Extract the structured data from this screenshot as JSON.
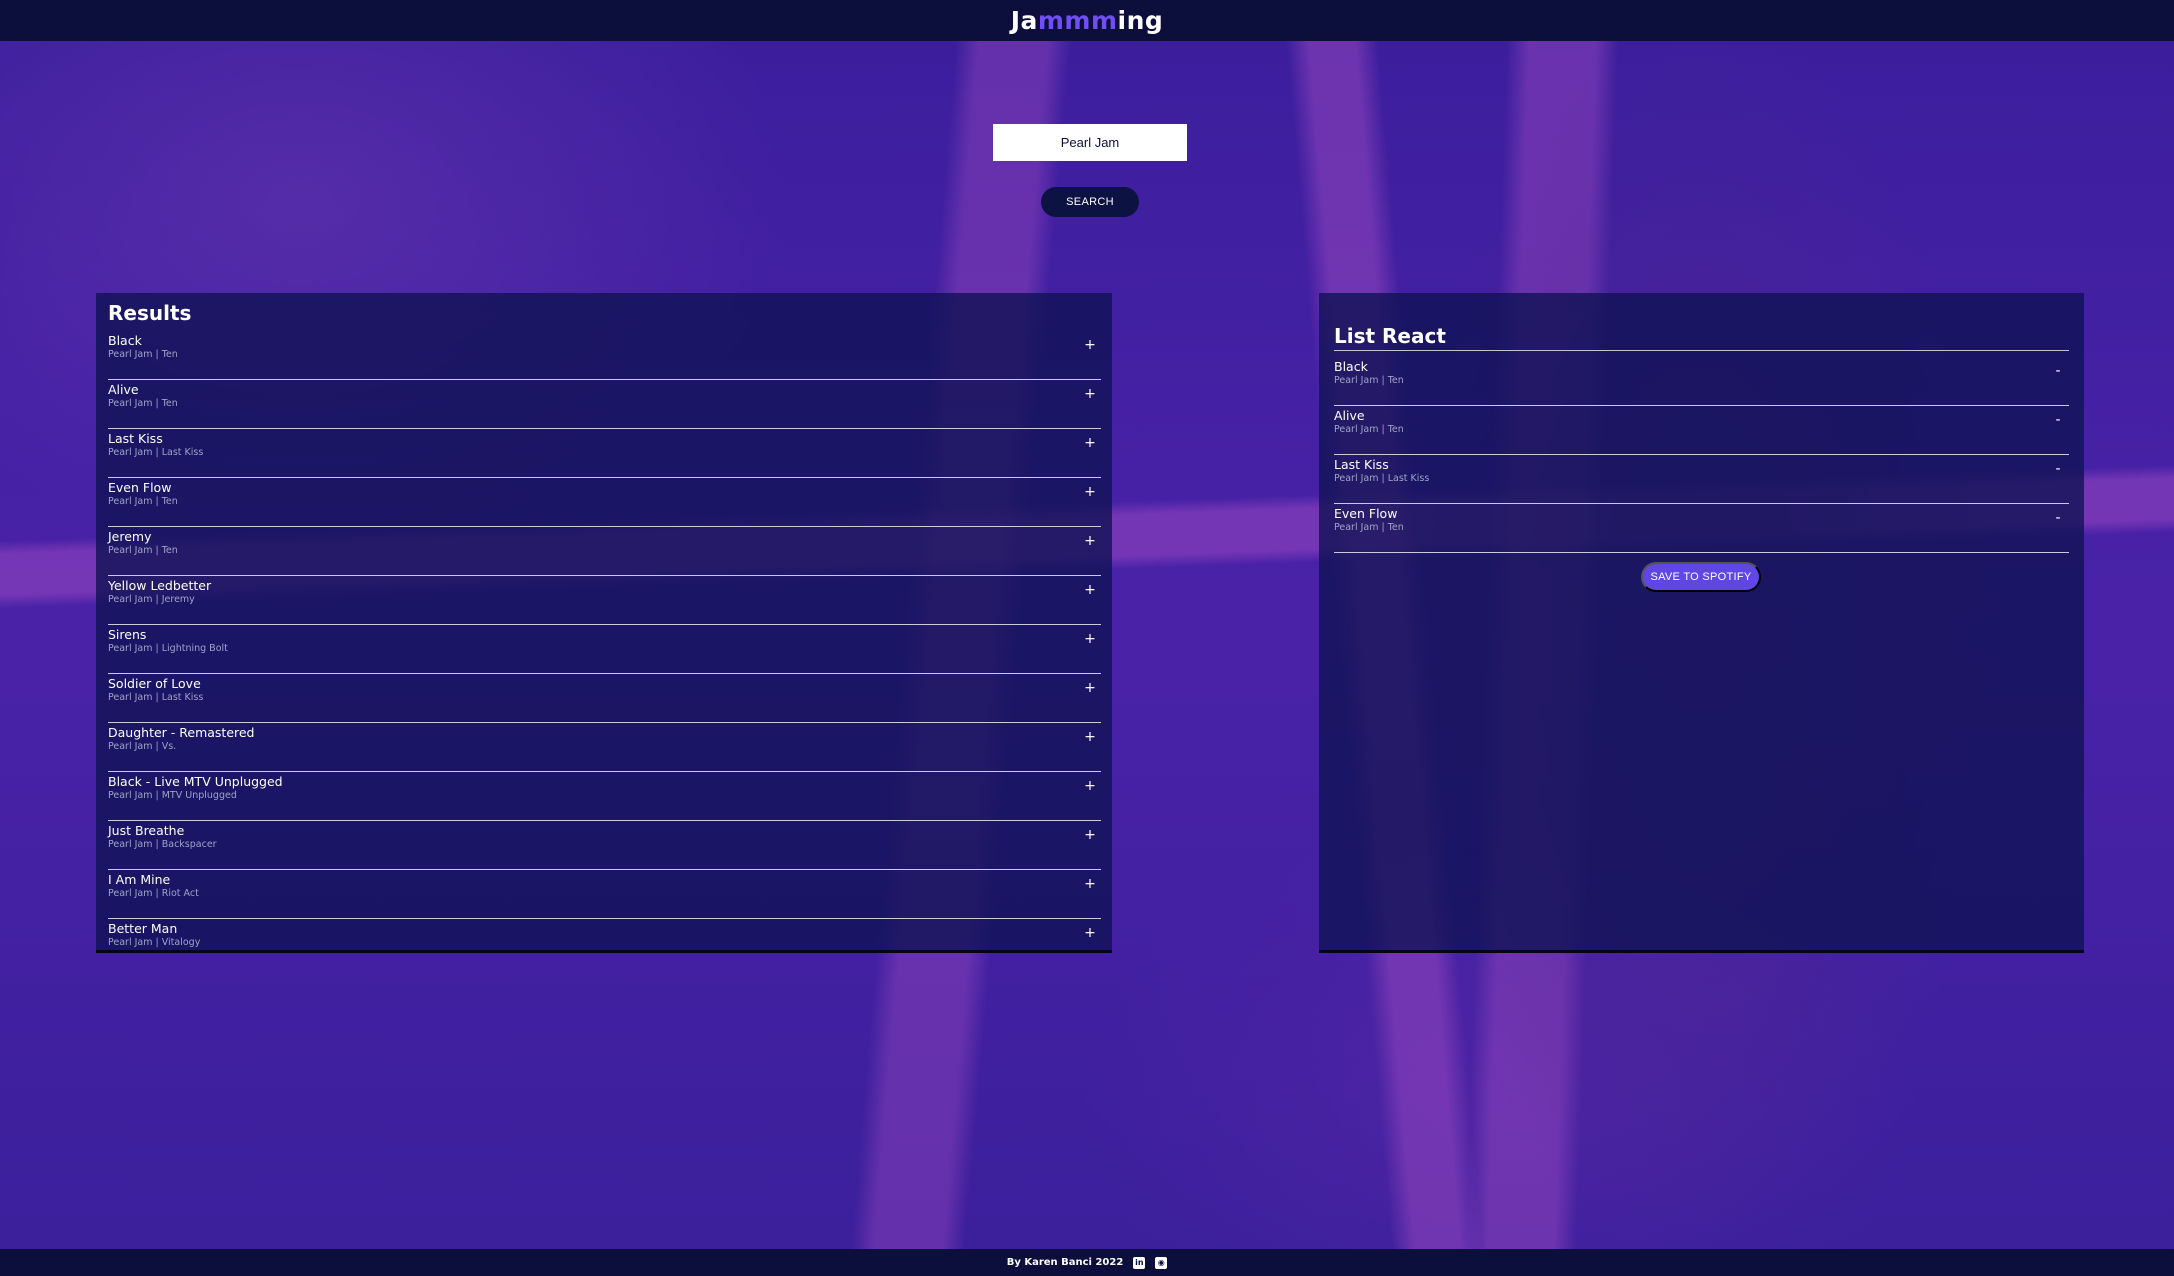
{
  "header": {
    "logo_prefix": "Ja",
    "logo_highlight": "mmm",
    "logo_suffix": "ing"
  },
  "search": {
    "value": "Pearl Jam",
    "button_label": "SEARCH"
  },
  "results": {
    "title": "Results",
    "action_symbol": "+",
    "tracks": [
      {
        "name": "Black",
        "info": "Pearl Jam | Ten"
      },
      {
        "name": "Alive",
        "info": "Pearl Jam | Ten"
      },
      {
        "name": "Last Kiss",
        "info": "Pearl Jam | Last Kiss"
      },
      {
        "name": "Even Flow",
        "info": "Pearl Jam | Ten"
      },
      {
        "name": "Jeremy",
        "info": "Pearl Jam | Ten"
      },
      {
        "name": "Yellow Ledbetter",
        "info": "Pearl Jam | Jeremy"
      },
      {
        "name": "Sirens",
        "info": "Pearl Jam | Lightning Bolt"
      },
      {
        "name": "Soldier of Love",
        "info": "Pearl Jam | Last Kiss"
      },
      {
        "name": "Daughter - Remastered",
        "info": "Pearl Jam | Vs."
      },
      {
        "name": "Black - Live MTV Unplugged",
        "info": "Pearl Jam | MTV Unplugged"
      },
      {
        "name": "Just Breathe",
        "info": "Pearl Jam | Backspacer"
      },
      {
        "name": "I Am Mine",
        "info": "Pearl Jam | Riot Act"
      },
      {
        "name": "Better Man",
        "info": "Pearl Jam | Vitalogy"
      }
    ]
  },
  "playlist": {
    "title": "List React",
    "action_symbol": "-",
    "tracks": [
      {
        "name": "Black",
        "info": "Pearl Jam | Ten"
      },
      {
        "name": "Alive",
        "info": "Pearl Jam | Ten"
      },
      {
        "name": "Last Kiss",
        "info": "Pearl Jam | Last Kiss"
      },
      {
        "name": "Even Flow",
        "info": "Pearl Jam | Ten"
      }
    ],
    "save_label": "SAVE TO SPOTIFY"
  },
  "footer": {
    "credit": "By Karen Banci 2022",
    "linkedin_icon": "linkedin-icon",
    "github_icon": "github-icon"
  },
  "colors": {
    "header_bg": "#0c0e3c",
    "accent": "#6f4ff2",
    "save_button": "#6146e6",
    "panel_bg": "#0e1252"
  }
}
